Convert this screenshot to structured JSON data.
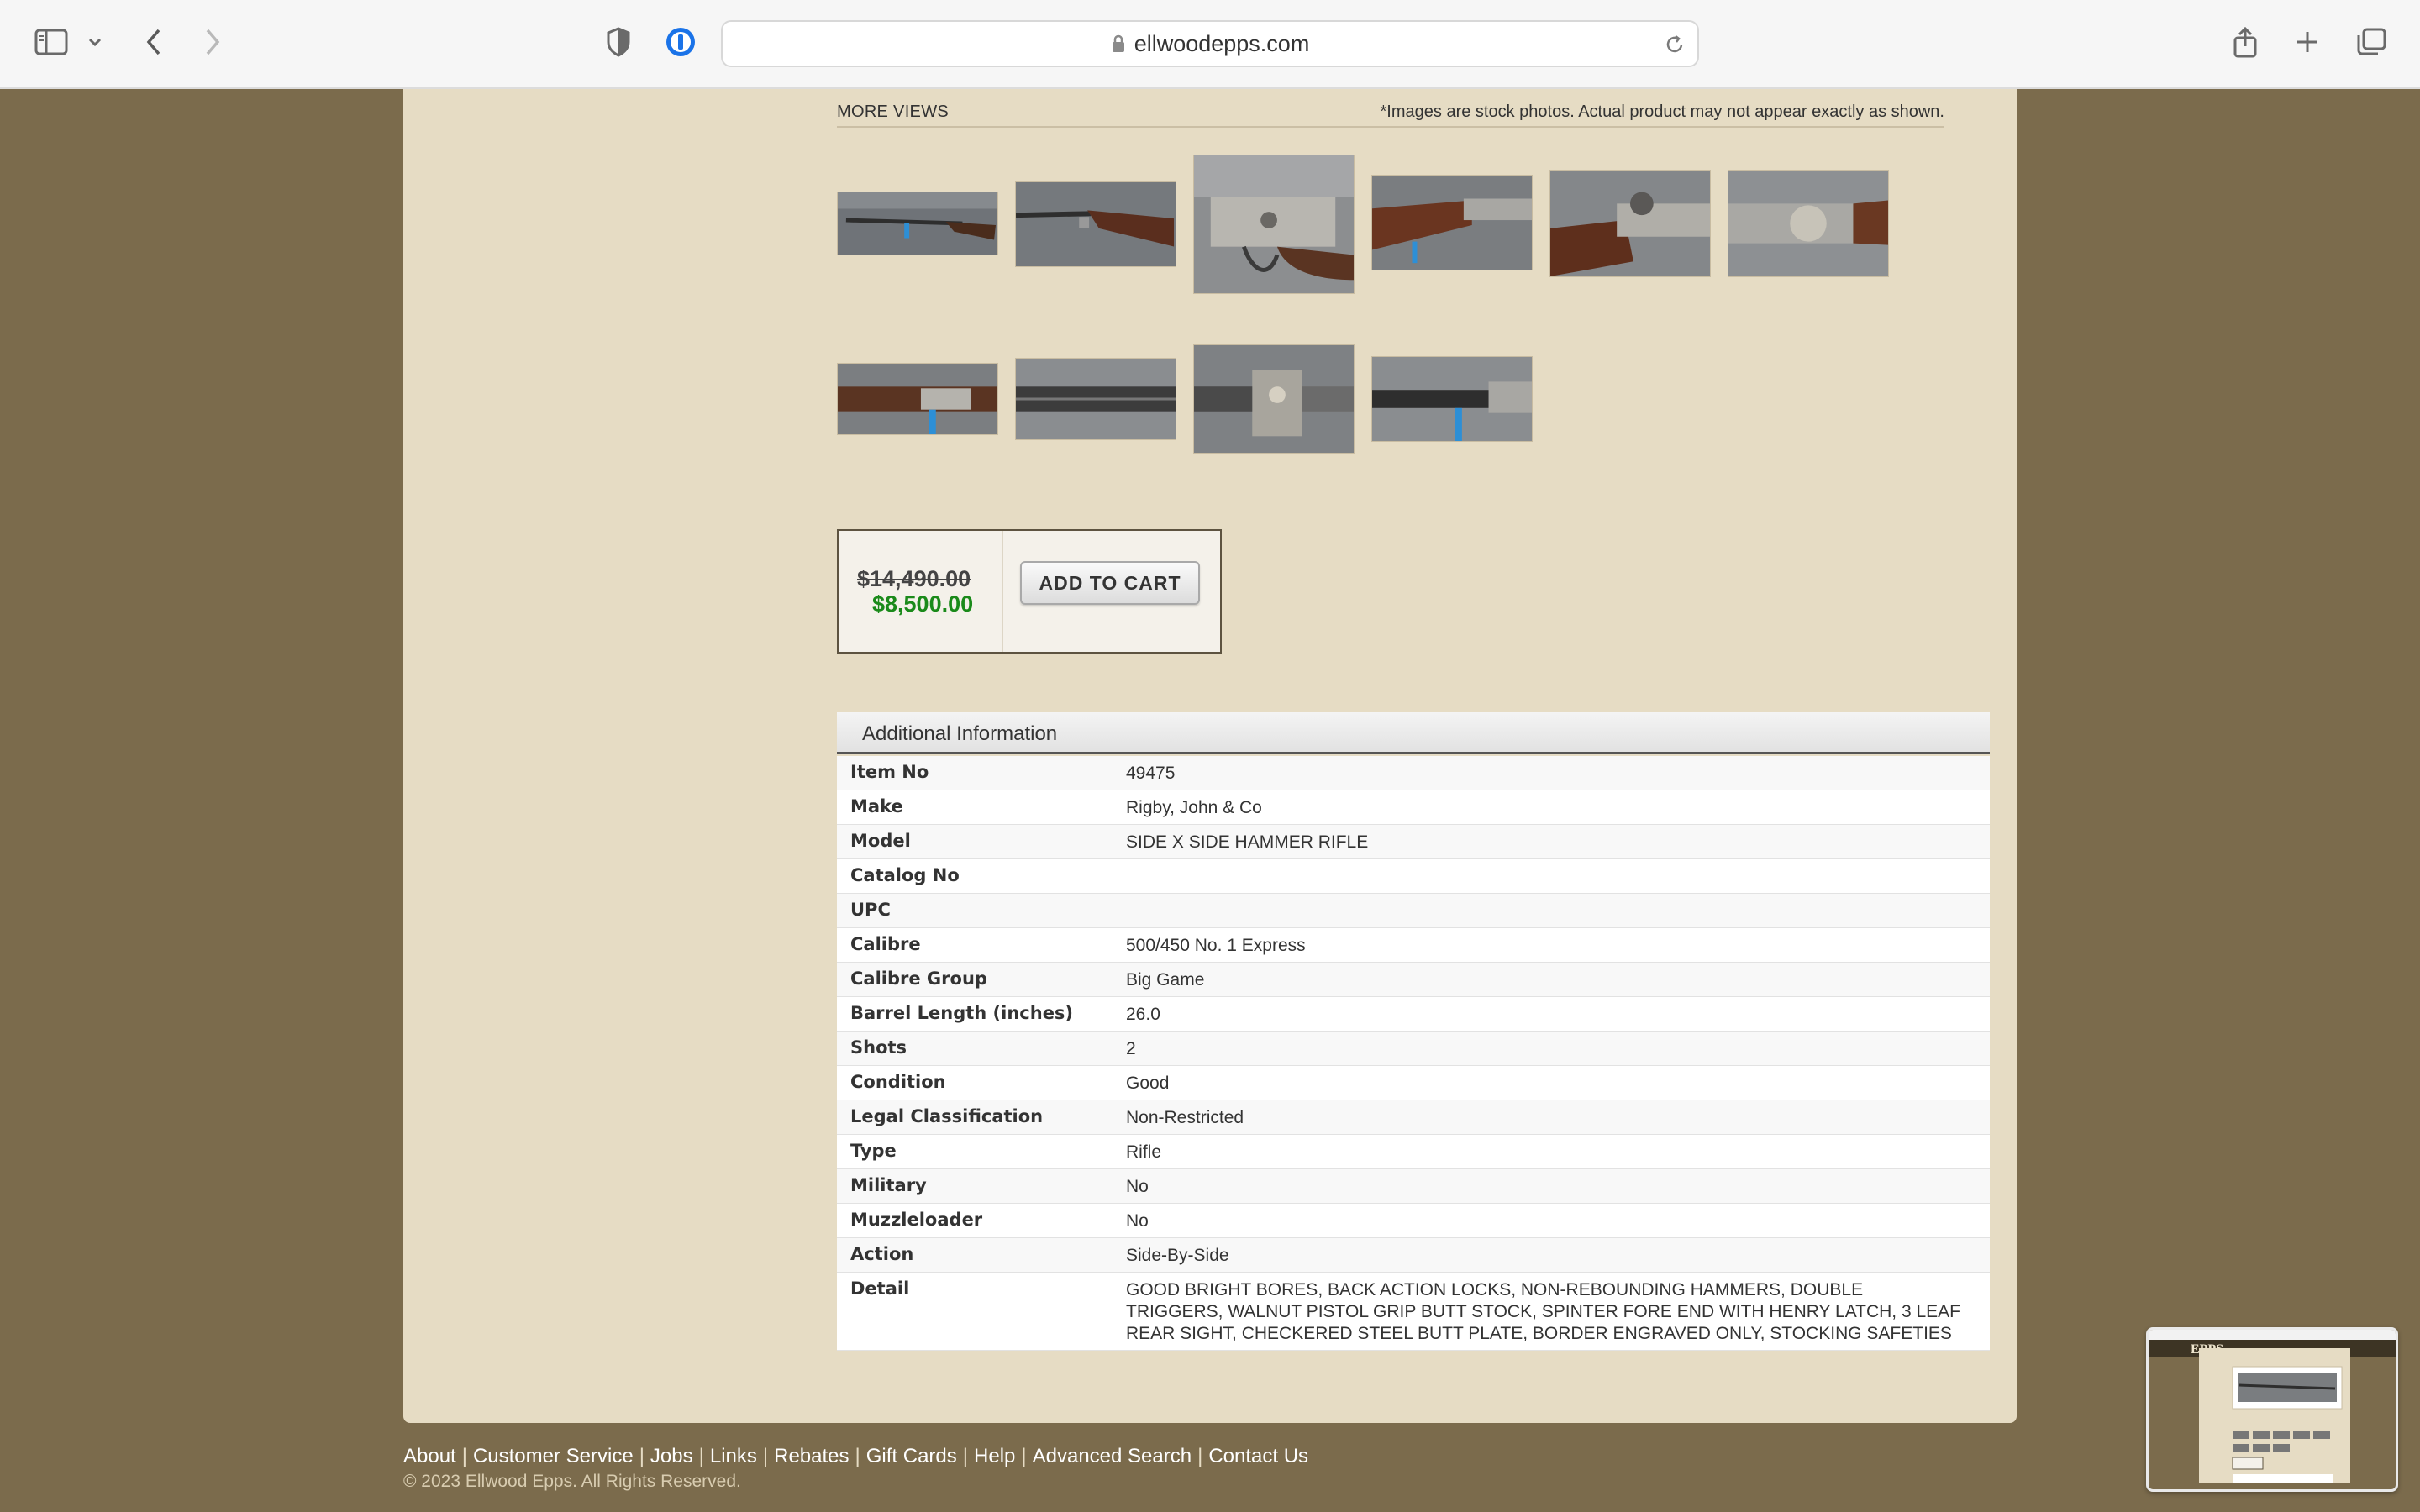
{
  "browser": {
    "url": "ellwoodepps.com"
  },
  "more_views": {
    "title": "MORE VIEWS",
    "note": "*Images are stock photos. Actual product may not appear exactly as shown."
  },
  "pricing": {
    "old_price": "$14,490.00",
    "new_price": "$8,500.00",
    "cart_label": "ADD TO CART"
  },
  "additional_info": {
    "title": "Additional Information",
    "rows": [
      {
        "label": "Item No",
        "value": "49475"
      },
      {
        "label": "Make",
        "value": "Rigby, John & Co"
      },
      {
        "label": "Model",
        "value": "SIDE X SIDE HAMMER RIFLE"
      },
      {
        "label": "Catalog No",
        "value": ""
      },
      {
        "label": "UPC",
        "value": ""
      },
      {
        "label": "Calibre",
        "value": "500/450 No. 1 Express"
      },
      {
        "label": "Calibre Group",
        "value": "Big Game"
      },
      {
        "label": "Barrel Length (inches)",
        "value": "26.0"
      },
      {
        "label": "Shots",
        "value": "2"
      },
      {
        "label": "Condition",
        "value": "Good"
      },
      {
        "label": "Legal Classification",
        "value": "Non-Restricted"
      },
      {
        "label": "Type",
        "value": "Rifle"
      },
      {
        "label": "Military",
        "value": "No"
      },
      {
        "label": "Muzzleloader",
        "value": "No"
      },
      {
        "label": "Action",
        "value": "Side-By-Side"
      },
      {
        "label": "Detail",
        "value": "GOOD BRIGHT BORES, BACK ACTION LOCKS, NON-REBOUNDING HAMMERS, DOUBLE TRIGGERS, WALNUT PISTOL GRIP BUTT STOCK, SPINTER FORE END WITH HENRY LATCH, 3 LEAF REAR SIGHT, CHECKERED STEEL BUTT PLATE, BORDER ENGRAVED ONLY, STOCKING SAFETIES"
      }
    ]
  },
  "footer": {
    "links": [
      "About",
      "Customer Service",
      "Jobs",
      "Links",
      "Rebates",
      "Gift Cards",
      "Help",
      "Advanced Search",
      "Contact Us"
    ],
    "copyright": "© 2023 Ellwood Epps. All Rights Reserved."
  },
  "minimap": {
    "logo": "EPPS"
  }
}
